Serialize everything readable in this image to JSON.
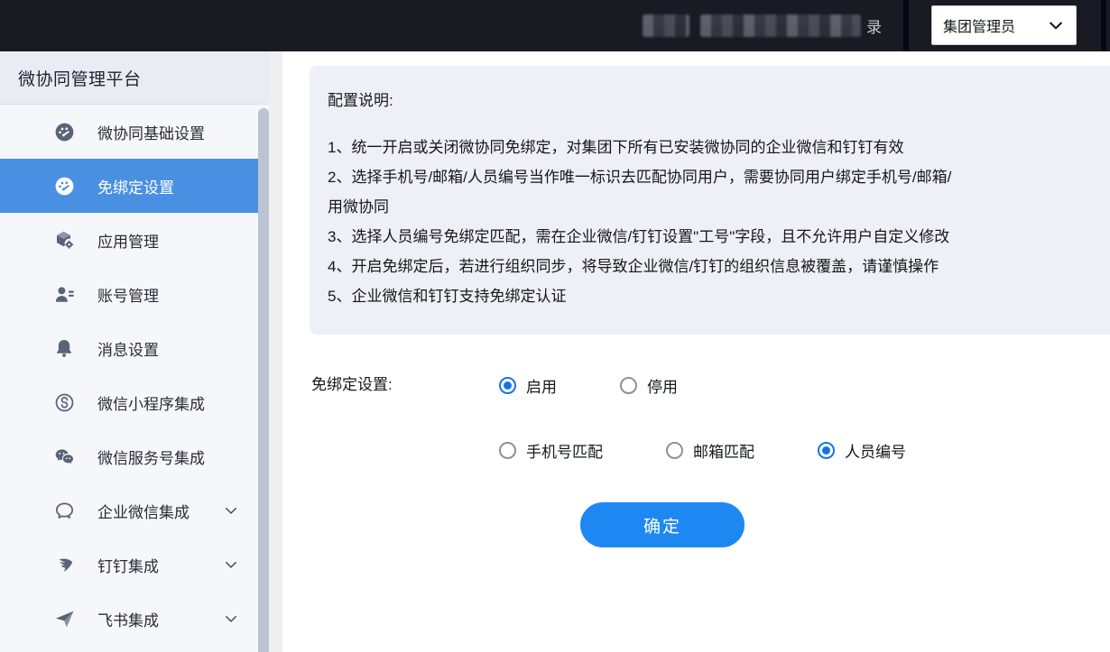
{
  "topbar": {
    "redacted_user_suffix": "录",
    "role_select": {
      "value": "集团管理员"
    }
  },
  "sidebar": {
    "title": "微协同管理平台",
    "items": [
      {
        "key": "wecollab-basic-settings",
        "icon": "dashboard-icon",
        "label": "微协同基础设置",
        "active": false,
        "expandable": false
      },
      {
        "key": "unbind-settings",
        "icon": "dashboard-icon",
        "label": "免绑定设置",
        "active": true,
        "expandable": false
      },
      {
        "key": "app-management",
        "icon": "app-cube-icon",
        "label": "应用管理",
        "active": false,
        "expandable": false
      },
      {
        "key": "account-management",
        "icon": "account-icon",
        "label": "账号管理",
        "active": false,
        "expandable": false
      },
      {
        "key": "message-settings",
        "icon": "bell-icon",
        "label": "消息设置",
        "active": false,
        "expandable": false
      },
      {
        "key": "wechat-miniprogram-integration",
        "icon": "miniprogram-icon",
        "label": "微信小程序集成",
        "active": false,
        "expandable": false
      },
      {
        "key": "wechat-service-account-integration",
        "icon": "wechat-icon",
        "label": "微信服务号集成",
        "active": false,
        "expandable": false
      },
      {
        "key": "wework-integration",
        "icon": "wework-icon",
        "label": "企业微信集成",
        "active": false,
        "expandable": true
      },
      {
        "key": "dingtalk-integration",
        "icon": "dingtalk-icon",
        "label": "钉钉集成",
        "active": false,
        "expandable": true
      },
      {
        "key": "feishu-integration",
        "icon": "feishu-icon",
        "label": "飞书集成",
        "active": false,
        "expandable": true
      }
    ]
  },
  "main": {
    "notice": {
      "title": "配置说明:",
      "lines": [
        "1、统一开启或关闭微协同免绑定，对集团下所有已安装微协同的企业微信和钉钉有效",
        "2、选择手机号/邮箱/人员编号当作唯一标识去匹配协同用户，需要协同用户绑定手机号/邮箱/",
        "用微协同",
        "3、选择人员编号免绑定匹配，需在企业微信/钉钉设置\"工号\"字段，且不允许用户自定义修改",
        "4、开启免绑定后，若进行组织同步，将导致企业微信/钉钉的组织信息被覆盖，请谨慎操作",
        "5、企业微信和钉钉支持免绑定认证"
      ]
    },
    "form": {
      "label": "免绑定设置:",
      "enable_group": {
        "options": [
          {
            "label": "启用",
            "selected": true
          },
          {
            "label": "停用",
            "selected": false
          }
        ]
      },
      "match_group": {
        "options": [
          {
            "label": "手机号匹配",
            "selected": false
          },
          {
            "label": "邮箱匹配",
            "selected": false
          },
          {
            "label": "人员编号",
            "selected": true
          }
        ]
      },
      "submit_label": "确定"
    }
  },
  "colors": {
    "topbar_bg": "#191a22",
    "sidebar_bg": "#f5f7fa",
    "sidebar_active_bg": "#4a90e2",
    "notice_bg": "#edf0f6",
    "button_blue": "#1e88f2",
    "radio_blue": "#1673e8"
  }
}
